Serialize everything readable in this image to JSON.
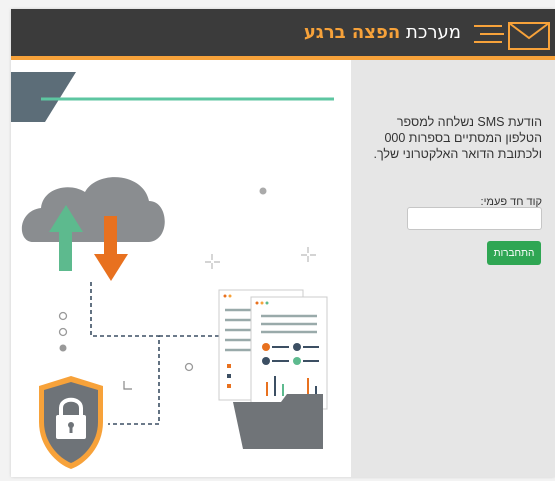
{
  "header": {
    "brand_prefix": "מערכת",
    "brand_name": "הפצה ברגע",
    "logo_icon": "envelope-speed-icon",
    "accent_color": "#f7a23a",
    "bg_color": "#3b3b3b"
  },
  "login": {
    "notice": "הודעת SMS נשלחה למספר הטלפון המסתיים בספרות 000 ולכתובת הדואר האלקטרוני שלך.",
    "otp_label": "קוד חד פעמי:",
    "otp_value": "",
    "button_label": "התחברות",
    "button_color": "#2fa653"
  },
  "illustration": {
    "icons": [
      "cloud-upload-download-icon",
      "shield-lock-icon",
      "documents-folder-icon"
    ]
  }
}
